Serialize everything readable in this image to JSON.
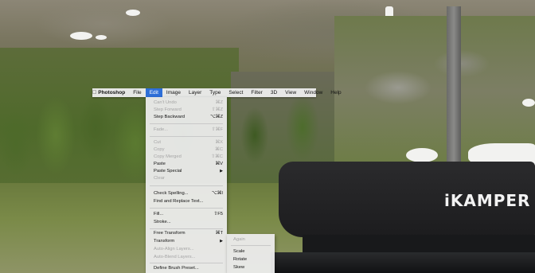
{
  "menubar": {
    "apple_icon": "apple-icon",
    "items": [
      "Photoshop",
      "File",
      "Edit",
      "Image",
      "Layer",
      "Type",
      "Select",
      "Filter",
      "3D",
      "View",
      "Window",
      "Help"
    ],
    "active": "Edit"
  },
  "edit_menu": {
    "items": [
      {
        "label": "Can't Undo",
        "shortcut": "⌘Z",
        "disabled": true
      },
      {
        "label": "Step Forward",
        "shortcut": "⇧⌘Z",
        "disabled": true
      },
      {
        "label": "Step Backward",
        "shortcut": "⌥⌘Z",
        "disabled": false
      },
      {
        "label": "Fade...",
        "shortcut": "⇧⌘F",
        "disabled": true
      },
      {
        "label": "Cut",
        "shortcut": "⌘X",
        "disabled": true
      },
      {
        "label": "Copy",
        "shortcut": "⌘C",
        "disabled": true
      },
      {
        "label": "Copy Merged",
        "shortcut": "⇧⌘C",
        "disabled": true
      },
      {
        "label": "Paste",
        "shortcut": "⌘V",
        "disabled": false
      },
      {
        "label": "Paste Special",
        "shortcut": "",
        "disabled": false
      },
      {
        "label": "Clear",
        "shortcut": "",
        "disabled": true
      },
      {
        "label": "Check Spelling...",
        "shortcut": "⌥⌘I",
        "disabled": false
      },
      {
        "label": "Find and Replace Text...",
        "shortcut": "",
        "disabled": false
      },
      {
        "label": "Fill...",
        "shortcut": "⇧F5",
        "disabled": false
      },
      {
        "label": "Stroke...",
        "shortcut": "",
        "disabled": false
      },
      {
        "label": "Free Transform",
        "shortcut": "⌘T",
        "disabled": false
      },
      {
        "label": "Transform",
        "shortcut": "",
        "disabled": false
      },
      {
        "label": "Auto-Align Layers...",
        "shortcut": "",
        "disabled": true
      },
      {
        "label": "Auto-Blend Layers...",
        "shortcut": "",
        "disabled": true
      },
      {
        "label": "Define Brush Preset...",
        "shortcut": "",
        "disabled": false
      }
    ]
  },
  "transform_submenu": {
    "items": [
      {
        "label": "Again",
        "disabled": true
      },
      {
        "label": "Scale",
        "disabled": false
      },
      {
        "label": "Rotate",
        "disabled": false
      },
      {
        "label": "Skew",
        "disabled": false
      }
    ]
  },
  "scene": {
    "brand_text": "iKAMPER"
  },
  "colors": {
    "menu_highlight": "#2e6fd8",
    "menu_bg": "#ececec",
    "disabled_text": "#a5a5a5"
  }
}
